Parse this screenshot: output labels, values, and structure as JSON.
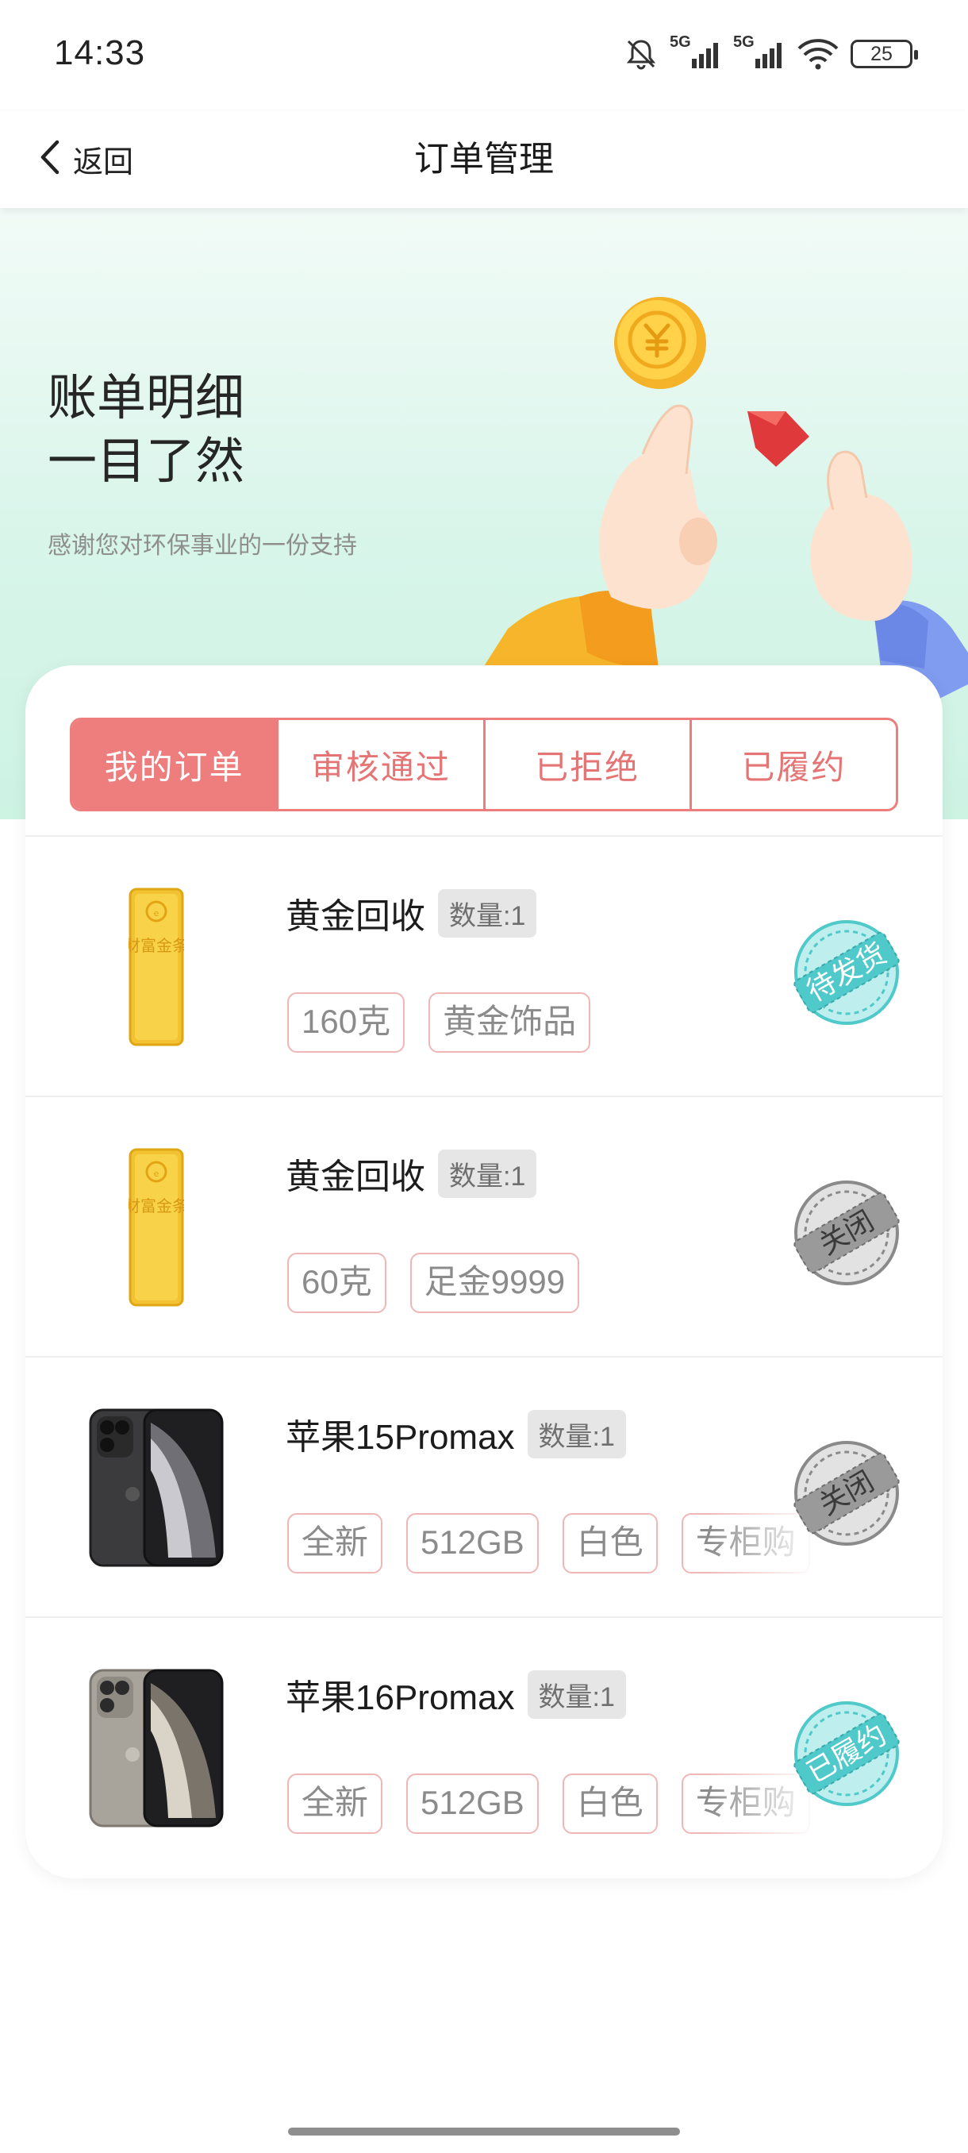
{
  "status_bar": {
    "time": "14:33",
    "signal_1": "5G",
    "signal_2": "5G",
    "battery": "25"
  },
  "nav": {
    "back_label": "返回",
    "title": "订单管理"
  },
  "banner": {
    "title_line1": "账单明细",
    "title_line2": "一目了然",
    "subtitle": "感谢您对环保事业的一份支持"
  },
  "tabs": [
    {
      "label": "我的订单",
      "active": true
    },
    {
      "label": "审核通过",
      "active": false
    },
    {
      "label": "已拒绝",
      "active": false
    },
    {
      "label": "已履约",
      "active": false
    }
  ],
  "orders": [
    {
      "name": "黄金回收",
      "quantity": "数量:1",
      "tags": [
        "160克",
        "黄金饰品"
      ],
      "status": "待发货",
      "status_color": "#4fc9c9",
      "image": "gold-bar"
    },
    {
      "name": "黄金回收",
      "quantity": "数量:1",
      "tags": [
        "60克",
        "足金9999"
      ],
      "status": "关闭",
      "status_color": "#8a8a8a",
      "image": "gold-bar"
    },
    {
      "name": "苹果15Promax",
      "quantity": "数量:1",
      "tags": [
        "全新",
        "512GB",
        "白色",
        "专柜购"
      ],
      "status": "关闭",
      "status_color": "#8a8a8a",
      "image": "phone-black"
    },
    {
      "name": "苹果16Promax",
      "quantity": "数量:1",
      "tags": [
        "全新",
        "512GB",
        "白色",
        "专柜购"
      ],
      "status": "已履约",
      "status_color": "#4fc9c9",
      "image": "phone-natural"
    }
  ],
  "gold_bar_text": "财富金条",
  "icons": [
    "mute-bell-icon",
    "signal-icon",
    "wifi-icon",
    "battery-icon",
    "chevron-left-icon",
    "coin-icon"
  ],
  "colors": {
    "accent": "#ee7d7d",
    "banner_bg": "#d8f5ea",
    "stamp_teal": "#4fc9c9",
    "stamp_gray": "#8a8a8a"
  }
}
